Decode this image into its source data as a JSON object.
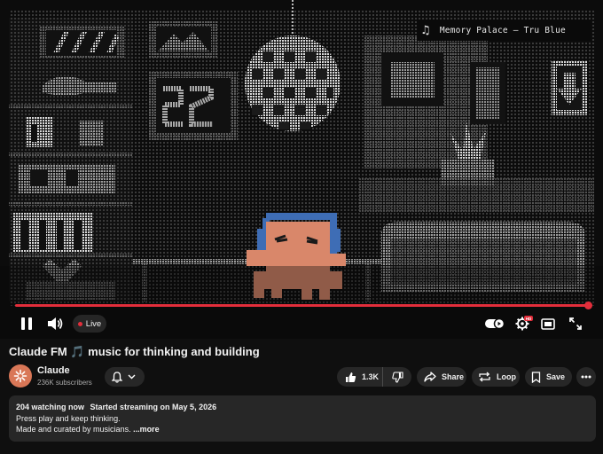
{
  "player": {
    "now_playing": "Memory Palace — Tru Blue",
    "live_label": "Live",
    "hd_badge": "HD",
    "progress_fraction": 0.99
  },
  "video": {
    "title": "Claude FM 🎵 music for thinking and building"
  },
  "channel": {
    "name": "Claude",
    "subscribers": "236K subscribers"
  },
  "actions": {
    "like_count": "1.3K",
    "share_label": "Share",
    "loop_label": "Loop",
    "save_label": "Save"
  },
  "description": {
    "watching": "204 watching now",
    "started": "Started streaming on May 5, 2026",
    "line1": "Press play and keep thinking.",
    "line2": "Made and curated by musicians.",
    "more_label": "...more"
  },
  "icons": {
    "pause": "pause-icon",
    "volume": "volume-icon",
    "autoplay": "autoplay-toggle-icon",
    "settings": "gear-icon",
    "theater": "theater-mode-icon",
    "fullscreen": "fullscreen-icon",
    "bell": "bell-icon",
    "like": "thumbs-up-icon",
    "dislike": "thumbs-down-icon",
    "share": "share-icon",
    "loop": "loop-icon",
    "save": "bookmark-icon",
    "more": "more-icon"
  },
  "colors": {
    "accent": "#e32e3b",
    "mascot": "#d9876a",
    "headphones": "#3e6db5",
    "chip_bg": "#272727",
    "page_bg": "#0f0f0f"
  }
}
